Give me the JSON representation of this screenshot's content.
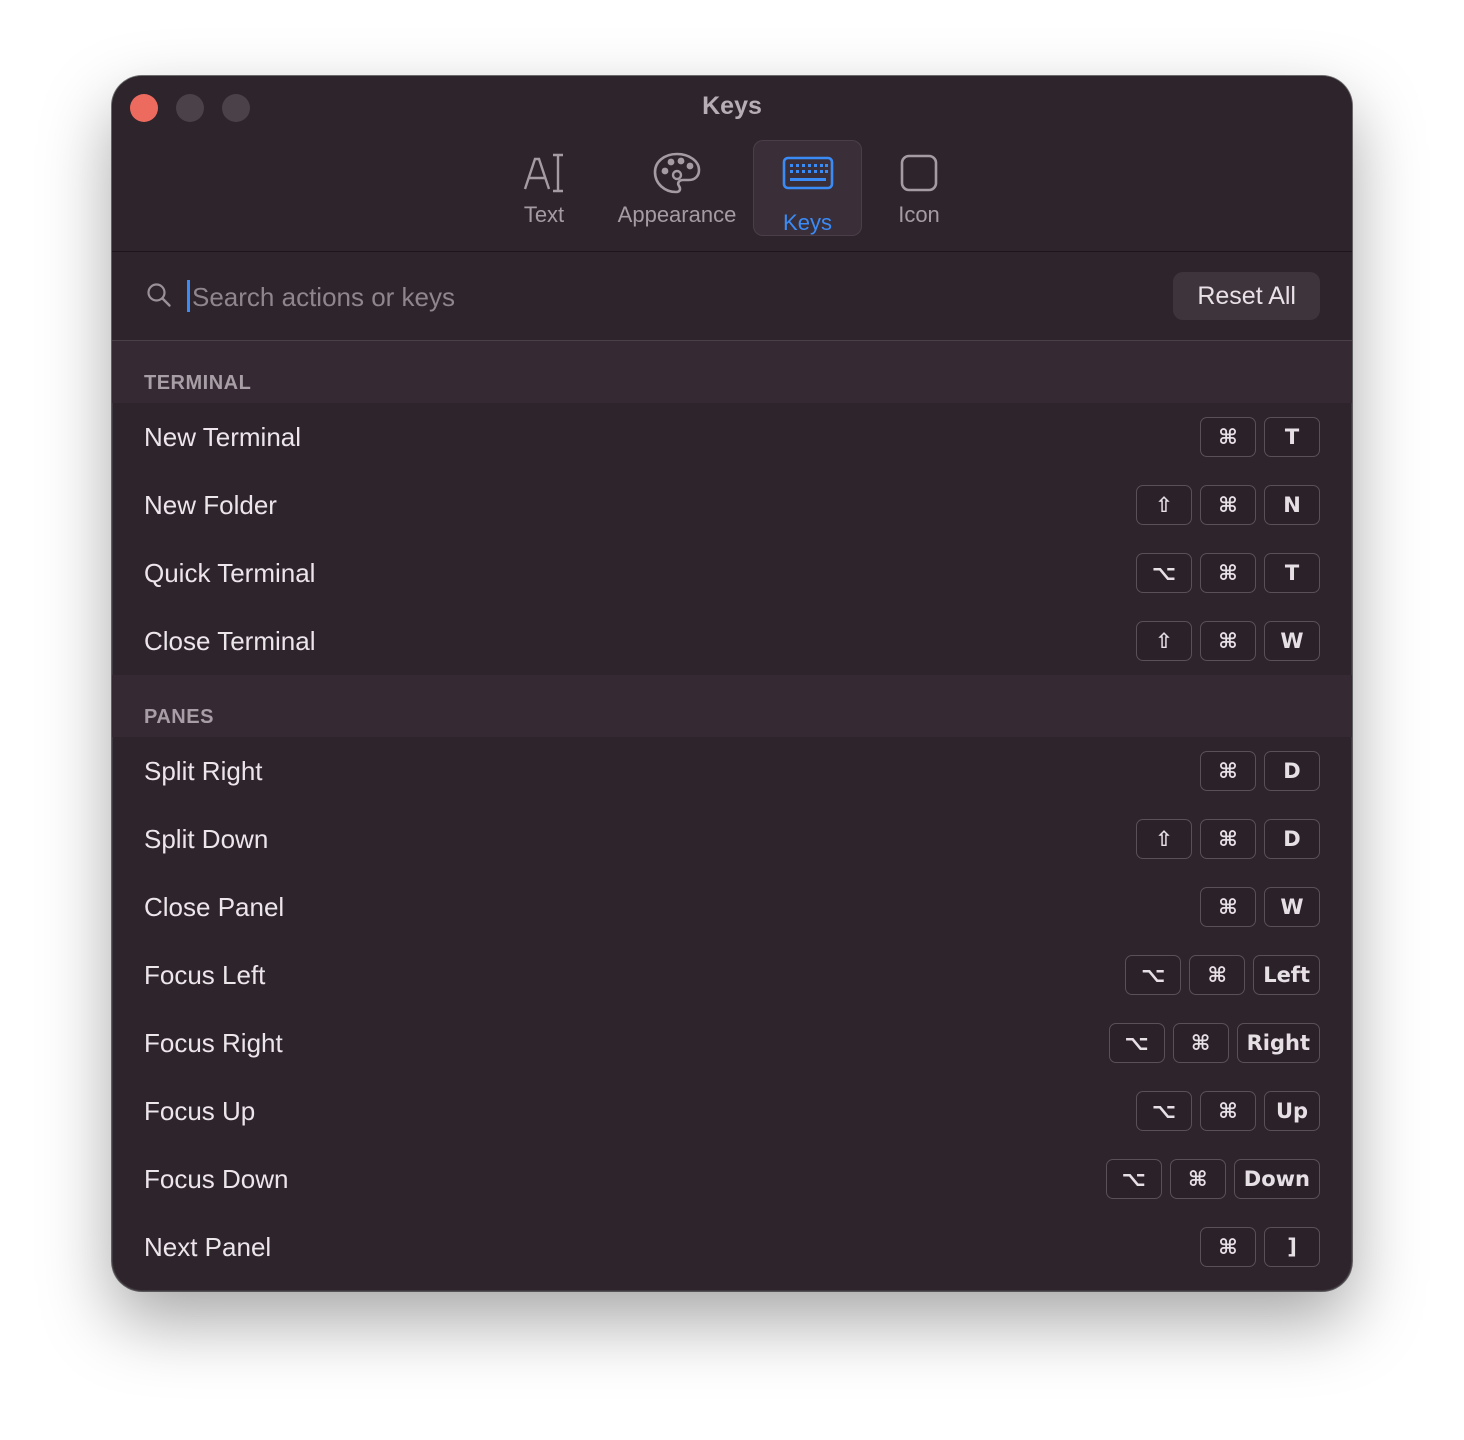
{
  "window": {
    "title": "Keys",
    "colors": {
      "close": "#ed6a5e",
      "accent": "#3a8bf6",
      "background": "#2d242c"
    }
  },
  "tabs": [
    {
      "id": "text",
      "label": "Text",
      "icon": "text-cursor-icon",
      "selected": false
    },
    {
      "id": "appearance",
      "label": "Appearance",
      "icon": "palette-icon",
      "selected": false
    },
    {
      "id": "keys",
      "label": "Keys",
      "icon": "keyboard-icon",
      "selected": true
    },
    {
      "id": "icon",
      "label": "Icon",
      "icon": "rounded-square-icon",
      "selected": false
    }
  ],
  "search": {
    "placeholder": "Search actions or keys",
    "value": "",
    "icon": "search-icon"
  },
  "reset_button": {
    "label": "Reset All"
  },
  "sections": [
    {
      "title": "TERMINAL",
      "rows": [
        {
          "action": "New Terminal",
          "keys": [
            "⌘",
            "T"
          ]
        },
        {
          "action": "New Folder",
          "keys": [
            "⇧",
            "⌘",
            "N"
          ]
        },
        {
          "action": "Quick Terminal",
          "keys": [
            "⌥",
            "⌘",
            "T"
          ]
        },
        {
          "action": "Close Terminal",
          "keys": [
            "⇧",
            "⌘",
            "W"
          ]
        }
      ]
    },
    {
      "title": "PANES",
      "rows": [
        {
          "action": "Split Right",
          "keys": [
            "⌘",
            "D"
          ]
        },
        {
          "action": "Split Down",
          "keys": [
            "⇧",
            "⌘",
            "D"
          ]
        },
        {
          "action": "Close Panel",
          "keys": [
            "⌘",
            "W"
          ]
        },
        {
          "action": "Focus Left",
          "keys": [
            "⌥",
            "⌘",
            "Left"
          ]
        },
        {
          "action": "Focus Right",
          "keys": [
            "⌥",
            "⌘",
            "Right"
          ]
        },
        {
          "action": "Focus Up",
          "keys": [
            "⌥",
            "⌘",
            "Up"
          ]
        },
        {
          "action": "Focus Down",
          "keys": [
            "⌥",
            "⌘",
            "Down"
          ]
        },
        {
          "action": "Next Panel",
          "keys": [
            "⌘",
            "]"
          ]
        }
      ]
    }
  ]
}
